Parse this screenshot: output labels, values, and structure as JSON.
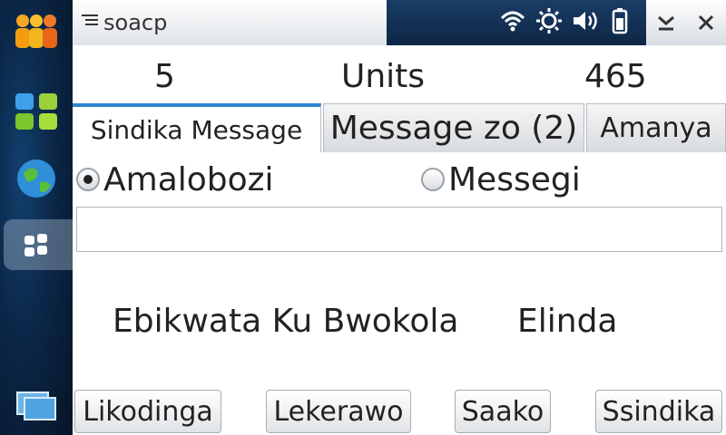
{
  "window": {
    "title": "soacp"
  },
  "counts": {
    "left_value": "5",
    "center_label": "Units",
    "right_value": "465"
  },
  "tabs": [
    {
      "label": "Sindika Message"
    },
    {
      "label": "Message zo  (2)"
    },
    {
      "label": "Amanya"
    }
  ],
  "radios": [
    {
      "label": "Amalobozi",
      "selected": true
    },
    {
      "label": "Messegi",
      "selected": false
    }
  ],
  "input": {
    "value": "",
    "placeholder": ""
  },
  "info": {
    "left": "Ebikwata Ku Bwokola",
    "right": "Elinda"
  },
  "buttons": {
    "likodinga": "Likodinga",
    "lekerawo": "Lekerawo",
    "saako": "Saako",
    "ssindika": "Ssindika"
  },
  "colors": {
    "accent": "#2d86d1",
    "dock_bg": "#0b2748"
  }
}
